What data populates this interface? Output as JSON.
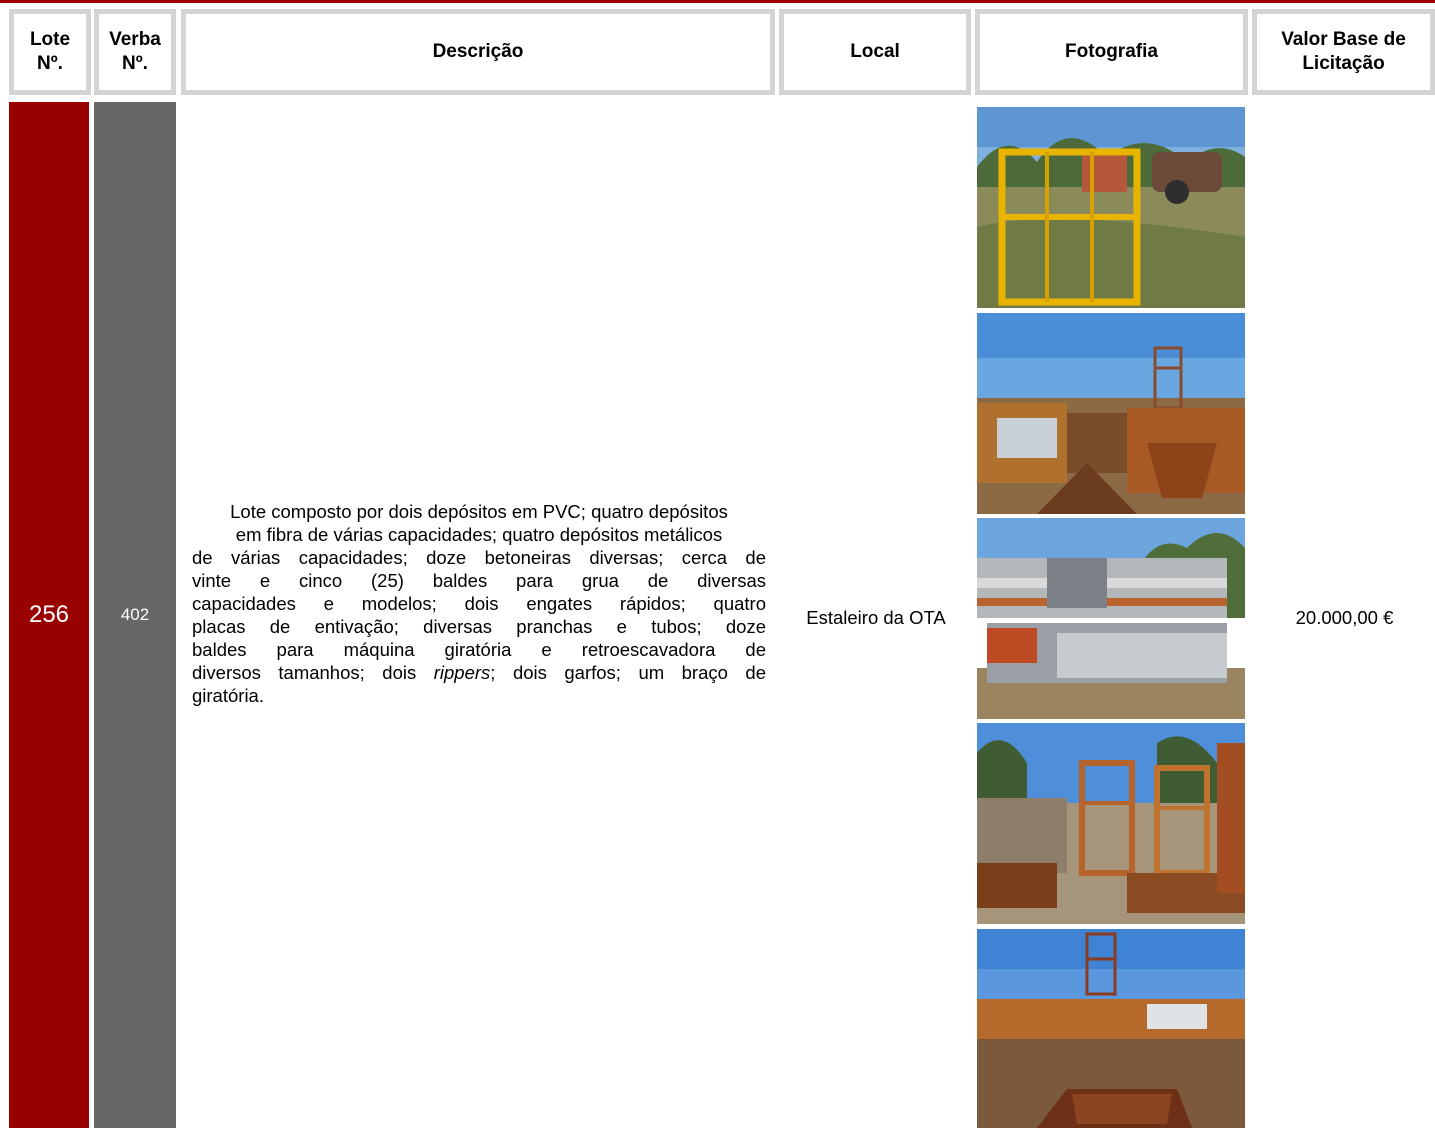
{
  "header": {
    "lote": "Lote\nNº.",
    "verba": "Verba\nNº.",
    "descricao": "Descrição",
    "local": "Local",
    "fotografia": "Fotografia",
    "valor": "Valor Base de\nLicitação"
  },
  "row": {
    "lote": "256",
    "verba": "402",
    "description": {
      "line1": "Lote composto por dois depósitos em PVC; quatro depósitos",
      "line2": "em fibra de várias capacidades; quatro depósitos metálicos",
      "line3": "de várias capacidades; doze betoneiras diversas; cerca de",
      "line4": "vinte e cinco (25) baldes para grua de diversas",
      "line5": "capacidades e modelos; dois engates rápidos; quatro",
      "line6": "placas de entivação; diversas pranchas e tubos; doze",
      "line7": "baldes para máquina giratória e retroescavadora de",
      "line8_a": "diversos tamanhos; dois ",
      "line8_em": "rippers",
      "line8_b": "; dois garfos; um braço de",
      "line9": "giratória."
    },
    "local": "Estaleiro da OTA",
    "valor": "20.000,00 €",
    "photos": [
      {
        "icon": "photo-yellow-cage-and-mixer"
      },
      {
        "icon": "photo-rusty-buckets-and-tower"
      },
      {
        "icon": "photo-stacked-metal-panels"
      },
      {
        "icon": "photo-rusty-cages"
      },
      {
        "icon": "photo-bucket-and-tower"
      }
    ]
  },
  "colors": {
    "accent_red": "#990000",
    "verba_grey": "#666666",
    "header_border": "#d4d4d4"
  }
}
